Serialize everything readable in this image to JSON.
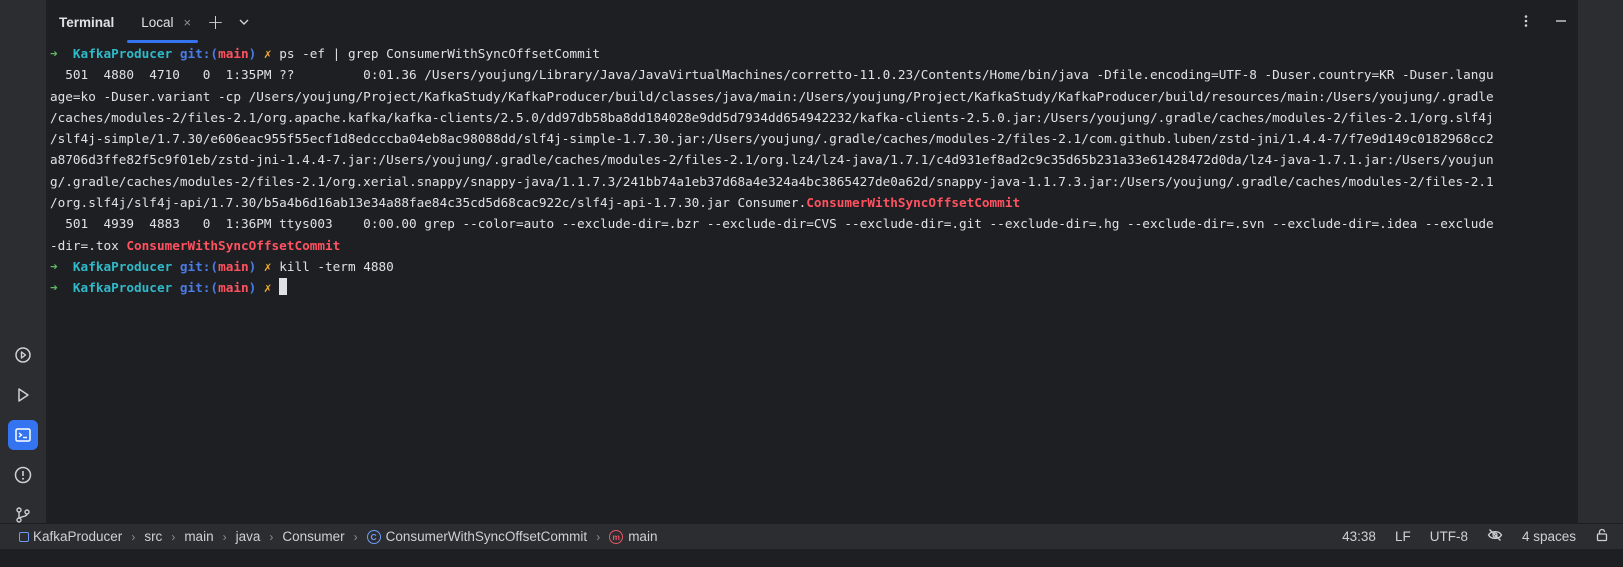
{
  "panel": {
    "title": "Terminal",
    "tab_label": "Local",
    "tab_close_glyph": "×",
    "add_glyph": "+"
  },
  "terminal": {
    "lines": [
      {
        "type": "prompt",
        "arrow": "➜",
        "dir": "KafkaProducer",
        "git": "git:(",
        "branch": "main",
        "git_close": ")",
        "mark": "✗",
        "cmd": "ps -ef | grep ConsumerWithSyncOffsetCommit"
      },
      {
        "type": "text",
        "text": "  501  4880  4710   0  1:35PM ??         0:01.36 /Users/youjung/Library/Java/JavaVirtualMachines/corretto-11.0.23/Contents/Home/bin/java -Dfile.encoding=UTF-8 -Duser.country=KR -Duser.langu"
      },
      {
        "type": "text",
        "text": "age=ko -Duser.variant -cp /Users/youjung/Project/KafkaStudy/KafkaProducer/build/classes/java/main:/Users/youjung/Project/KafkaStudy/KafkaProducer/build/resources/main:/Users/youjung/.gradle"
      },
      {
        "type": "text",
        "text": "/caches/modules-2/files-2.1/org.apache.kafka/kafka-clients/2.5.0/dd97db58ba8dd184028e9dd5d7934dd654942232/kafka-clients-2.5.0.jar:/Users/youjung/.gradle/caches/modules-2/files-2.1/org.slf4j"
      },
      {
        "type": "text",
        "text": "/slf4j-simple/1.7.30/e606eac955f55ecf1d8edcccba04eb8ac98088dd/slf4j-simple-1.7.30.jar:/Users/youjung/.gradle/caches/modules-2/files-2.1/com.github.luben/zstd-jni/1.4.4-7/f7e9d149c0182968cc2"
      },
      {
        "type": "text",
        "text": "a8706d3ffe82f5c9f01eb/zstd-jni-1.4.4-7.jar:/Users/youjung/.gradle/caches/modules-2/files-2.1/org.lz4/lz4-java/1.7.1/c4d931ef8ad2c9c35d65b231a33e61428472d0da/lz4-java-1.7.1.jar:/Users/youjun"
      },
      {
        "type": "text",
        "text": "g/.gradle/caches/modules-2/files-2.1/org.xerial.snappy/snappy-java/1.1.7.3/241bb74a1eb37d68a4e324a4bc3865427de0a62d/snappy-java-1.1.7.3.jar:/Users/youjung/.gradle/caches/modules-2/files-2.1"
      },
      {
        "type": "hl",
        "text": "/org.slf4j/slf4j-api/1.7.30/b5a4b6d16ab13e34a88fae84c35cd5d68cac922c/slf4j-api-1.7.30.jar Consumer.",
        "highlight": "ConsumerWithSyncOffsetCommit"
      },
      {
        "type": "text",
        "text": "  501  4939  4883   0  1:36PM ttys003    0:00.00 grep --color=auto --exclude-dir=.bzr --exclude-dir=CVS --exclude-dir=.git --exclude-dir=.hg --exclude-dir=.svn --exclude-dir=.idea --exclude"
      },
      {
        "type": "hl",
        "text": "-dir=.tox ",
        "highlight": "ConsumerWithSyncOffsetCommit"
      },
      {
        "type": "prompt",
        "arrow": "➜",
        "dir": "KafkaProducer",
        "git": "git:(",
        "branch": "main",
        "git_close": ")",
        "mark": "✗",
        "cmd": "kill -term 4880"
      },
      {
        "type": "prompt_cursor",
        "arrow": "➜",
        "dir": "KafkaProducer",
        "git": "git:(",
        "branch": "main",
        "git_close": ")",
        "mark": "✗",
        "cmd": ""
      }
    ]
  },
  "left_toolbar": {
    "items": [
      {
        "name": "services-icon",
        "active": false
      },
      {
        "name": "run-icon",
        "active": false
      },
      {
        "name": "terminal-icon",
        "active": true
      },
      {
        "name": "problems-icon",
        "active": false
      },
      {
        "name": "git-icon",
        "active": false
      }
    ]
  },
  "statusbar": {
    "breadcrumbs": [
      "KafkaProducer",
      "src",
      "main",
      "java",
      "Consumer",
      "ConsumerWithSyncOffsetCommit",
      "main"
    ],
    "crumb_sep": "›",
    "class_glyph": "C",
    "method_glyph": "m",
    "position": "43:38",
    "line_ending": "LF",
    "encoding": "UTF-8",
    "indent": "4 spaces"
  }
}
